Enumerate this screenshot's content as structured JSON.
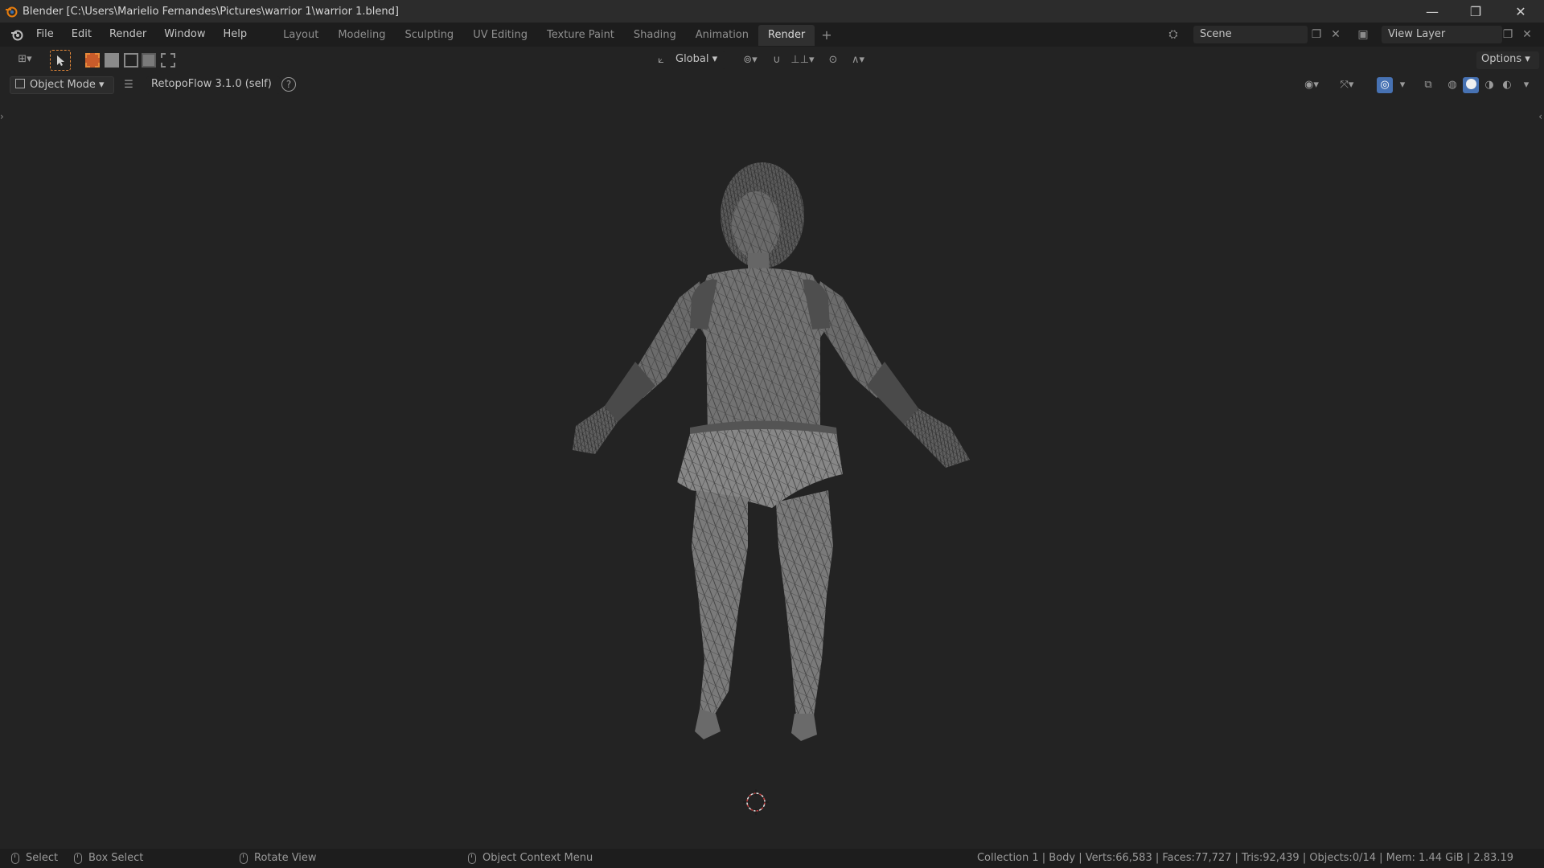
{
  "window": {
    "title": "Blender [C:\\Users\\Marielio Fernandes\\Pictures\\warrior 1\\warrior 1.blend]",
    "minimize": "—",
    "maximize": "❐",
    "close": "✕"
  },
  "menu": {
    "file": "File",
    "edit": "Edit",
    "render": "Render",
    "window": "Window",
    "help": "Help"
  },
  "workspaces": [
    {
      "label": "Layout",
      "active": false
    },
    {
      "label": "Modeling",
      "active": false
    },
    {
      "label": "Sculpting",
      "active": false
    },
    {
      "label": "UV Editing",
      "active": false
    },
    {
      "label": "Texture Paint",
      "active": false
    },
    {
      "label": "Shading",
      "active": false
    },
    {
      "label": "Animation",
      "active": false
    },
    {
      "label": "Render",
      "active": true
    }
  ],
  "workspace_add": "+",
  "scene": {
    "name": "Scene",
    "view_layer": "View Layer"
  },
  "toolheader": {
    "transform_orientation": "Global",
    "options": "Options"
  },
  "viewheader": {
    "mode": "Object Mode",
    "addon": "RetopoFlow 3.1.0 (self)"
  },
  "status": {
    "select": "Select",
    "box_select": "Box Select",
    "rotate_view": "Rotate View",
    "context_menu": "Object Context Menu",
    "stats": "Collection 1 | Body | Verts:66,583 | Faces:77,727 | Tris:92,439 | Objects:0/14 | Mem: 1.44 GiB | 2.83.19"
  },
  "colors": {
    "accent_orange": "#e88a3a",
    "active_blue": "#4772b3",
    "cursor_red": "#c04040"
  },
  "icons": {
    "blender_logo": "blender-logo-icon",
    "editor_type": "editor-type-icon",
    "select_tool": "cursor-arrow-icon",
    "pivot": "pivot-icon",
    "snap": "magnet-icon",
    "proportional": "proportional-edit-icon",
    "overlay": "overlay-icon",
    "gizmo": "gizmo-icon",
    "xray": "xray-icon",
    "shading_wire": "wireframe-shading-icon",
    "shading_solid": "solid-shading-icon",
    "shading_material": "material-shading-icon",
    "shading_render": "rendered-shading-icon"
  }
}
